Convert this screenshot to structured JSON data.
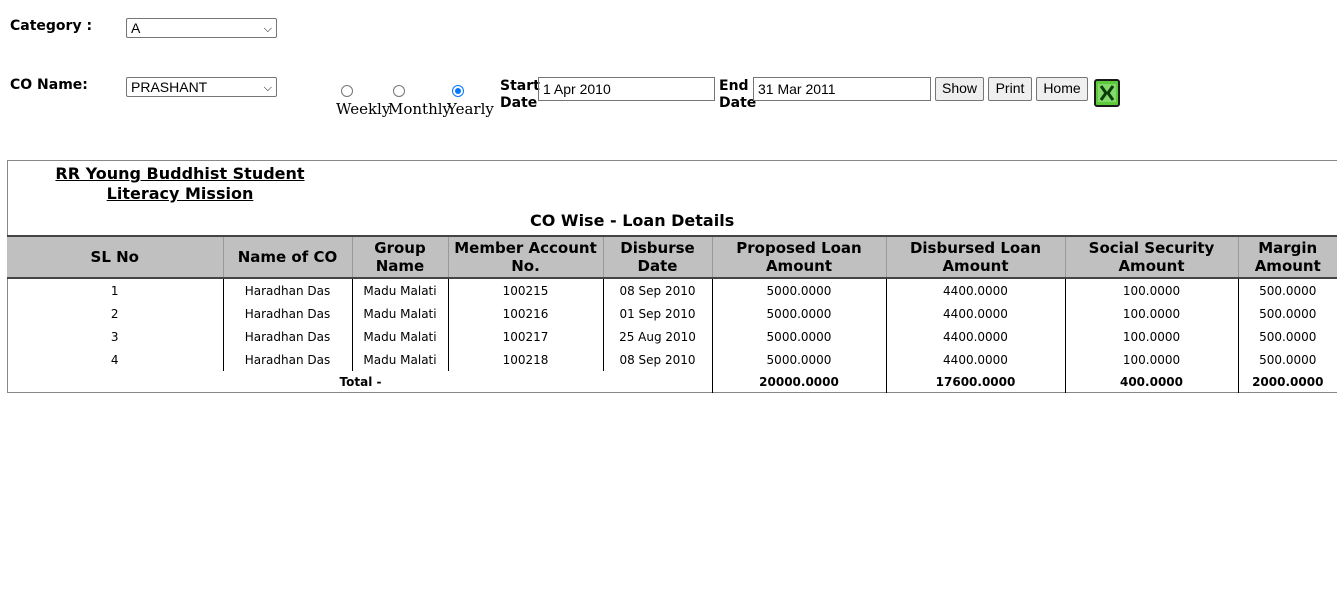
{
  "filters": {
    "category_label": "Category :",
    "category_value": "A",
    "co_label": "CO Name:",
    "co_value": "PRASHANT",
    "period_options": [
      "Weekly",
      "Monthly",
      "Yearly"
    ],
    "period_selected": "Yearly",
    "start_label_1": "Start",
    "start_label_2": "Date",
    "start_value": "1 Apr 2010",
    "end_label_1": "End",
    "end_label_2": "Date",
    "end_value": "31 Mar 2011",
    "show_label": "Show",
    "print_label": "Print",
    "home_label": "Home",
    "export_icon": "excel-icon"
  },
  "report": {
    "org_name": "RR Young Buddhist Student Literacy Mission",
    "title": "CO Wise - Loan Details",
    "columns": [
      "SL No",
      "Name of CO",
      "Group Name",
      "Member Account No.",
      "Disburse Date",
      "Proposed Loan Amount",
      "Disbursed Loan Amount",
      "Social Security Amount",
      "Margin Amount"
    ],
    "rows": [
      [
        "1",
        "Haradhan Das",
        "Madu Malati",
        "100215",
        "08 Sep 2010",
        "5000.0000",
        "4400.0000",
        "100.0000",
        "500.0000"
      ],
      [
        "2",
        "Haradhan Das",
        "Madu Malati",
        "100216",
        "01 Sep 2010",
        "5000.0000",
        "4400.0000",
        "100.0000",
        "500.0000"
      ],
      [
        "3",
        "Haradhan Das",
        "Madu Malati",
        "100217",
        "25 Aug 2010",
        "5000.0000",
        "4400.0000",
        "100.0000",
        "500.0000"
      ],
      [
        "4",
        "Haradhan Das",
        "Madu Malati",
        "100218",
        "08 Sep 2010",
        "5000.0000",
        "4400.0000",
        "100.0000",
        "500.0000"
      ]
    ],
    "total_label": "Total -",
    "totals": [
      "20000.0000",
      "17600.0000",
      "400.0000",
      "2000.0000"
    ]
  }
}
